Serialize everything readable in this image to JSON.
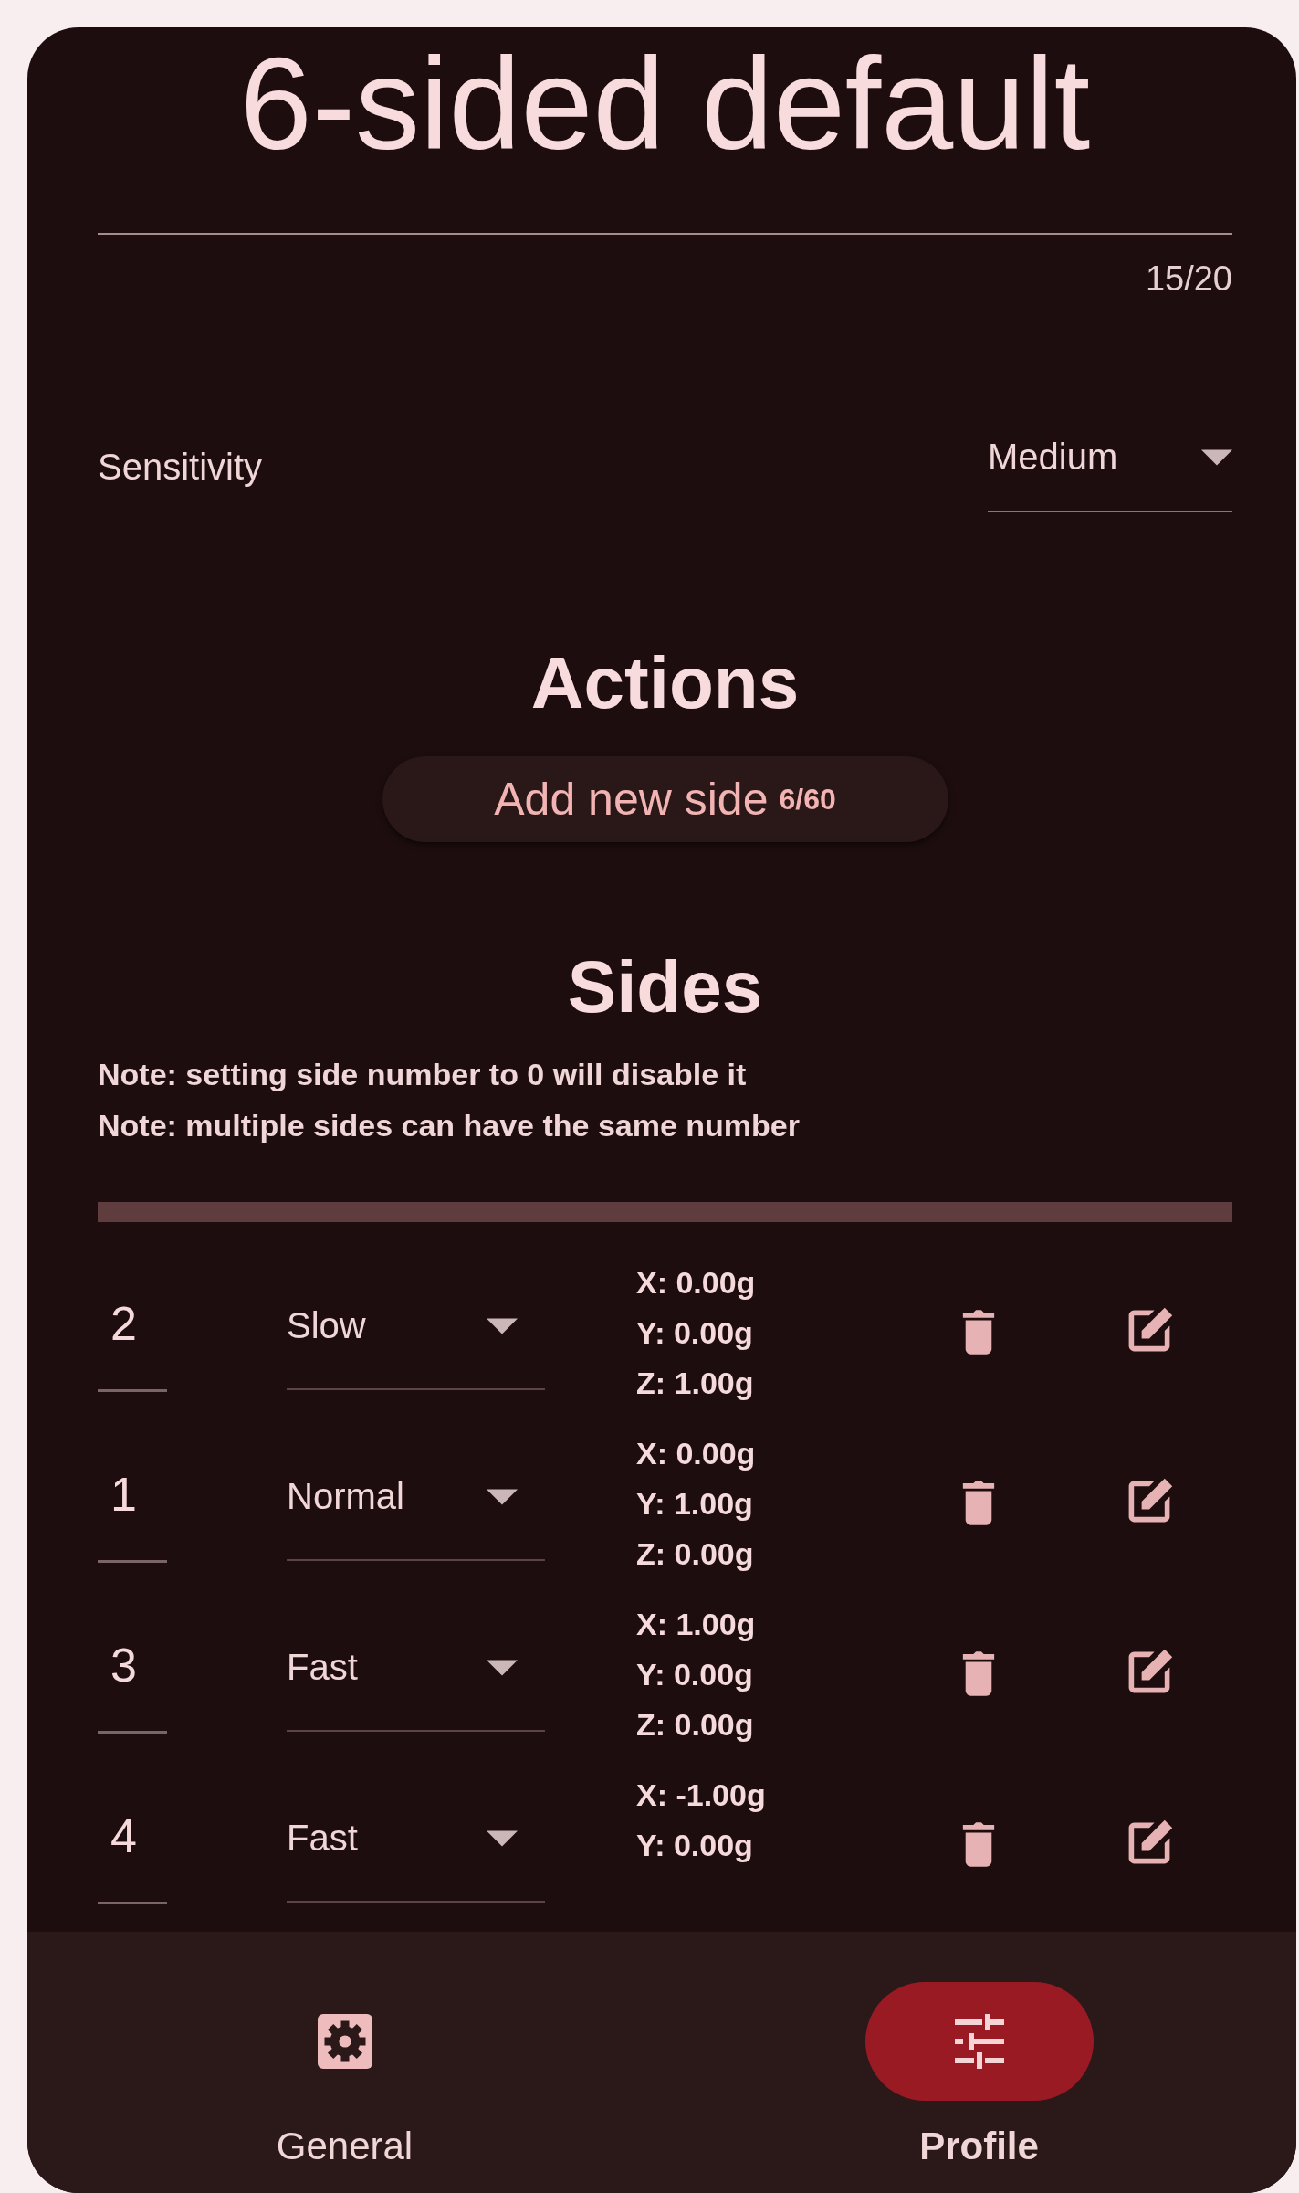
{
  "profile": {
    "title": "6-sided default",
    "counter": "15/20"
  },
  "sensitivity": {
    "label": "Sensitivity",
    "value": "Medium"
  },
  "actions": {
    "heading": "Actions",
    "button": {
      "label": "Add new side",
      "count": "6/60"
    }
  },
  "sides": {
    "heading": "Sides",
    "notes": [
      "Note: setting side number to 0 will disable it",
      "Note: multiple sides can have the same number"
    ],
    "rows": [
      {
        "number": "2",
        "speed": "Slow",
        "values": [
          "X: 0.00g",
          "Y: 0.00g",
          "Z: 1.00g"
        ]
      },
      {
        "number": "1",
        "speed": "Normal",
        "values": [
          "X: 0.00g",
          "Y: 1.00g",
          "Z: 0.00g"
        ]
      },
      {
        "number": "3",
        "speed": "Fast",
        "values": [
          "X: 1.00g",
          "Y: 0.00g",
          "Z: 0.00g"
        ]
      },
      {
        "number": "4",
        "speed": "Fast",
        "values": [
          "X: -1.00g",
          "Y: 0.00g"
        ]
      }
    ]
  },
  "nav": [
    {
      "label": "General",
      "kind": "gear",
      "selected": false
    },
    {
      "label": "Profile",
      "kind": "sliders",
      "selected": true
    }
  ]
}
